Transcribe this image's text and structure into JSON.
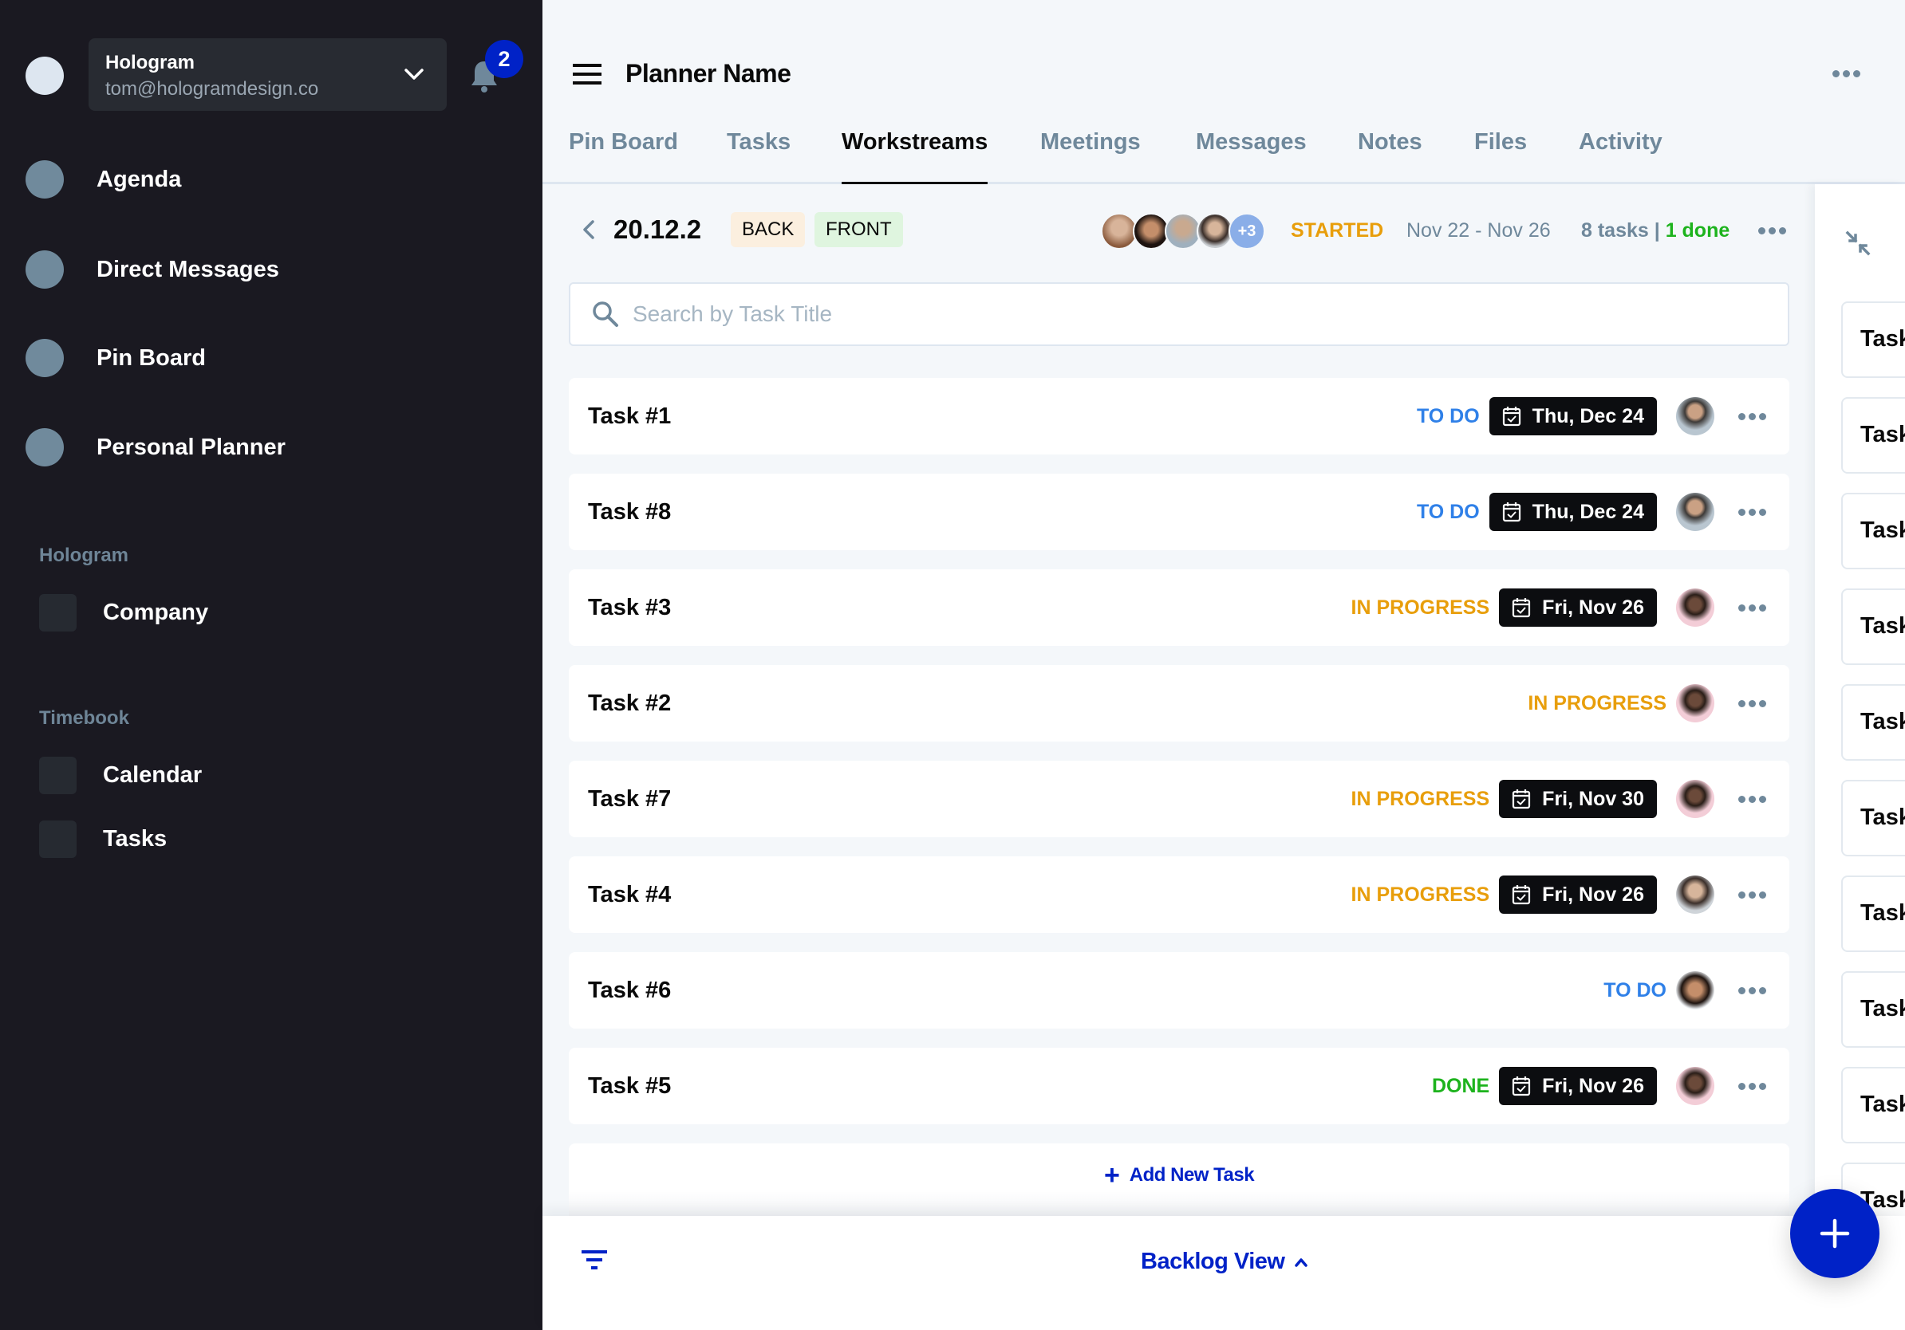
{
  "sidebar": {
    "workspace": {
      "name": "Hologram",
      "email": "tom@hologramdesign.co"
    },
    "notifications": {
      "count": "2"
    },
    "nav": [
      {
        "label": "Agenda"
      },
      {
        "label": "Direct Messages"
      },
      {
        "label": "Pin Board"
      },
      {
        "label": "Personal Planner"
      }
    ],
    "sections": [
      {
        "label": "Hologram",
        "items": [
          {
            "label": "Company"
          }
        ]
      },
      {
        "label": "Timebook",
        "items": [
          {
            "label": "Calendar"
          },
          {
            "label": "Tasks"
          }
        ]
      }
    ]
  },
  "header": {
    "title": "Planner Name",
    "tabs": [
      {
        "label": "Pin Board"
      },
      {
        "label": "Tasks"
      },
      {
        "label": "Workstreams",
        "active": true
      },
      {
        "label": "Meetings"
      },
      {
        "label": "Messages"
      },
      {
        "label": "Notes"
      },
      {
        "label": "Files"
      },
      {
        "label": "Activity"
      }
    ]
  },
  "sprint": {
    "title": "20.12.2",
    "tags": [
      {
        "label": "BACK",
        "color": "#fbefdf"
      },
      {
        "label": "FRONT",
        "color": "#dff5df"
      }
    ],
    "members_more": "+3",
    "status": "STARTED",
    "date_range": "Nov 22 - Nov 26",
    "task_count": "8 tasks | ",
    "done_count": "1 done"
  },
  "search": {
    "placeholder": "Search by Task Title",
    "value": ""
  },
  "status_colors": {
    "TO DO": "#2f80e8",
    "IN PROGRESS": "#e89e0b",
    "DONE": "#1db31d"
  },
  "tasks": [
    {
      "title": "Task #1",
      "status": "TO DO",
      "due": "Thu, Dec 24",
      "assignee": "man-light"
    },
    {
      "title": "Task #8",
      "status": "TO DO",
      "due": "Thu, Dec 24",
      "assignee": "man-light"
    },
    {
      "title": "Task #3",
      "status": "IN PROGRESS",
      "due": "Fri, Nov 26",
      "assignee": "woman-pink"
    },
    {
      "title": "Task #2",
      "status": "IN PROGRESS",
      "due": null,
      "assignee": "woman-pink"
    },
    {
      "title": "Task #7",
      "status": "IN PROGRESS",
      "due": "Fri, Nov 30",
      "assignee": "woman-pink"
    },
    {
      "title": "Task #4",
      "status": "IN PROGRESS",
      "due": "Fri, Nov 26",
      "assignee": "woman-grey"
    },
    {
      "title": "Task #6",
      "status": "TO DO",
      "due": null,
      "assignee": "man-curly"
    },
    {
      "title": "Task #5",
      "status": "DONE",
      "due": "Fri, Nov 26",
      "assignee": "woman-pink"
    }
  ],
  "add_task": {
    "label": "Add New Task"
  },
  "bottom_bar": {
    "view_label": "Backlog View"
  },
  "right_panel": {
    "cards": [
      "Task",
      "Task",
      "Task",
      "Task",
      "Task",
      "Task",
      "Task",
      "Task",
      "Task",
      "Task"
    ]
  },
  "icons": {
    "menu": "hamburger-icon",
    "bell": "bell-icon",
    "more": "more-horizontal-icon",
    "search": "search-icon",
    "calendar": "calendar-check-icon",
    "filter": "filter-icon",
    "compress": "compress-icon",
    "add": "plus-icon"
  },
  "colors": {
    "accent": "#0022c7",
    "sidebar_bg": "#1a1921",
    "muted": "#6f889b"
  }
}
